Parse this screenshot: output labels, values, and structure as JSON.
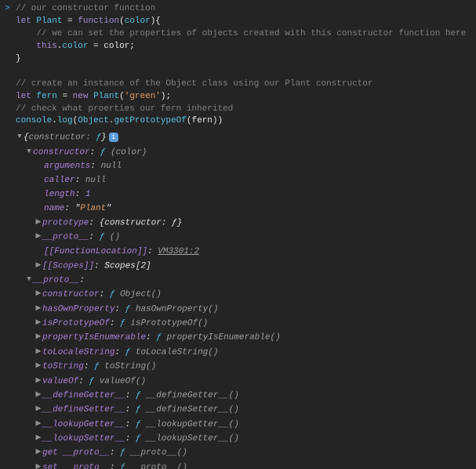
{
  "code": {
    "l1_prompt": ">",
    "l1": "// our constructor function",
    "l2_let": "let",
    "l2_name": "Plant",
    "l2_eq": "=",
    "l2_func": "function",
    "l2_param": "color",
    "l3": "// we can set the properties of objects created with this constructor function here",
    "l4_this": "this",
    "l4_prop": "color",
    "l4_eq": "=",
    "l4_val": "color",
    "l5_close": "}",
    "l7": "// create an instance of the Object class using our Plant constructor",
    "l8_let": "let",
    "l8_name": "fern",
    "l8_eq": "=",
    "l8_new": "new",
    "l8_ctor": "Plant",
    "l8_arg": "'green'",
    "l9": "// check what proerties our fern inherited",
    "l10_console": "console",
    "l10_log": "log",
    "l10_obj": "Object",
    "l10_gpo": "getPrototypeOf",
    "l10_arg": "fern"
  },
  "tree": {
    "root_summary_open": "{",
    "root_summary_label": "constructor",
    "root_summary_f": "ƒ",
    "root_summary_close": "}",
    "constructor": {
      "label": "constructor",
      "f": "ƒ",
      "sig": "(color)",
      "arguments_k": "arguments",
      "arguments_v": "null",
      "caller_k": "caller",
      "caller_v": "null",
      "length_k": "length",
      "length_v": "1",
      "name_k": "name",
      "name_v_q1": "\"",
      "name_v": "Plant",
      "name_v_q2": "\"",
      "prototype_k": "prototype",
      "prototype_v": "{constructor: ƒ}",
      "proto_k": "__proto__",
      "proto_f": "ƒ",
      "proto_sig": "()",
      "funcloc_k": "[[FunctionLocation]]",
      "funcloc_v": "VM3301:2",
      "scopes_k": "[[Scopes]]",
      "scopes_v": "Scopes[2]"
    },
    "proto": {
      "label": "__proto__",
      "items": [
        {
          "k": "constructor",
          "sig": "Object()"
        },
        {
          "k": "hasOwnProperty",
          "sig": "hasOwnProperty()"
        },
        {
          "k": "isPrototypeOf",
          "sig": "isPrototypeOf()"
        },
        {
          "k": "propertyIsEnumerable",
          "sig": "propertyIsEnumerable()"
        },
        {
          "k": "toLocaleString",
          "sig": "toLocaleString()"
        },
        {
          "k": "toString",
          "sig": "toString()"
        },
        {
          "k": "valueOf",
          "sig": "valueOf()"
        },
        {
          "k": "__defineGetter__",
          "sig": "__defineGetter__()"
        },
        {
          "k": "__defineSetter__",
          "sig": "__defineSetter__()"
        },
        {
          "k": "__lookupGetter__",
          "sig": "__lookupGetter__()"
        },
        {
          "k": "__lookupSetter__",
          "sig": "__lookupSetter__()"
        },
        {
          "k": "get __proto__",
          "sig": "__proto__()"
        },
        {
          "k": "set __proto__",
          "sig": "__proto__()"
        }
      ]
    },
    "f": "ƒ",
    "colon": ":"
  },
  "glyphs": {
    "right": "▶",
    "down": "▼",
    "info": "i"
  }
}
